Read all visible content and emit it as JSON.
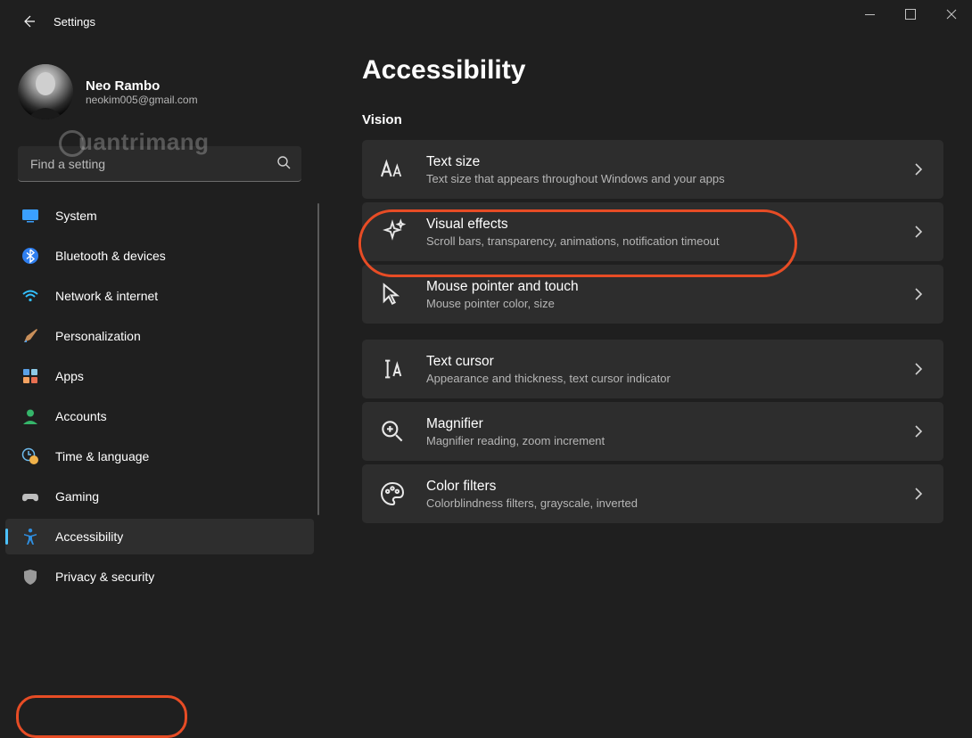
{
  "window": {
    "app_title": "Settings"
  },
  "profile": {
    "name": "Neo Rambo",
    "email": "neokim005@gmail.com"
  },
  "watermark": "uantrimang",
  "search": {
    "placeholder": "Find a setting"
  },
  "sidebar": {
    "items": [
      {
        "label": "System",
        "icon": "monitor"
      },
      {
        "label": "Bluetooth & devices",
        "icon": "bluetooth"
      },
      {
        "label": "Network & internet",
        "icon": "wifi"
      },
      {
        "label": "Personalization",
        "icon": "brush"
      },
      {
        "label": "Apps",
        "icon": "apps"
      },
      {
        "label": "Accounts",
        "icon": "person"
      },
      {
        "label": "Time & language",
        "icon": "clock-globe"
      },
      {
        "label": "Gaming",
        "icon": "gamepad"
      },
      {
        "label": "Accessibility",
        "icon": "accessibility",
        "selected": true,
        "highlighted": true
      },
      {
        "label": "Privacy & security",
        "icon": "shield"
      }
    ]
  },
  "page": {
    "title": "Accessibility",
    "sections": [
      {
        "title": "Vision",
        "items": [
          {
            "title": "Text size",
            "subtitle": "Text size that appears throughout Windows and your apps",
            "icon": "text-size"
          },
          {
            "title": "Visual effects",
            "subtitle": "Scroll bars, transparency, animations, notification timeout",
            "icon": "sparkle",
            "highlighted": true
          },
          {
            "title": "Mouse pointer and touch",
            "subtitle": "Mouse pointer color, size",
            "icon": "pointer",
            "spaced_after": true
          },
          {
            "title": "Text cursor",
            "subtitle": "Appearance and thickness, text cursor indicator",
            "icon": "text-cursor"
          },
          {
            "title": "Magnifier",
            "subtitle": "Magnifier reading, zoom increment",
            "icon": "magnifier"
          },
          {
            "title": "Color filters",
            "subtitle": "Colorblindness filters, grayscale, inverted",
            "icon": "palette"
          }
        ]
      }
    ]
  }
}
